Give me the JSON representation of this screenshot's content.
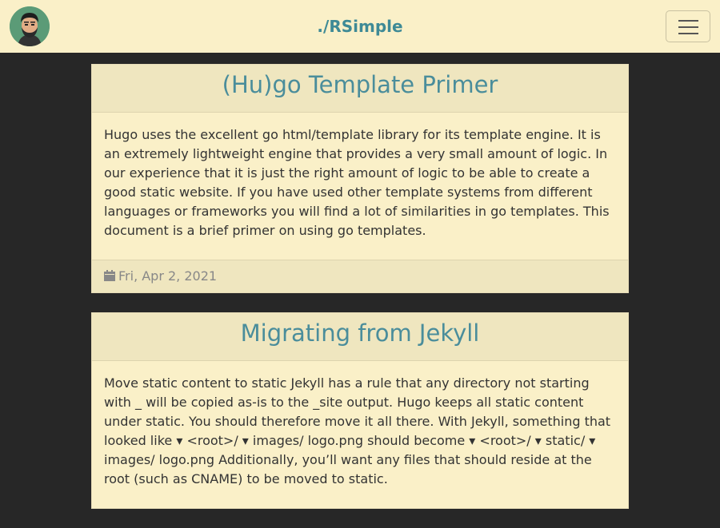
{
  "navbar": {
    "brand": "./RSimple",
    "avatar_icon": "avatar-icon",
    "menu_icon": "hamburger-menu-icon"
  },
  "posts": [
    {
      "title": "(Hu)go Template Primer",
      "summary": "Hugo uses the excellent go html/template library for its template engine. It is an extremely lightweight engine that provides a very small amount of logic. In our experience that it is just the right amount of logic to be able to create a good static website. If you have used other template systems from different languages or frameworks you will find a lot of similarities in go templates. This document is a brief primer on using go templates.",
      "date": "Fri, Apr 2, 2021"
    },
    {
      "title": "Migrating from Jekyll",
      "summary": "Move static content to static Jekyll has a rule that any directory not starting with _ will be copied as-is to the _site output. Hugo keeps all static content under static. You should therefore move it all there. With Jekyll, something that looked like ▾ <root>/ ▾ images/ logo.png should become ▾ <root>/ ▾ static/ ▾ images/ logo.png Additionally, you’ll want any files that should reside at the root (such as CNAME) to be moved to static.",
      "date": ""
    }
  ],
  "colors": {
    "page_bg": "#272727",
    "card_bg": "#faf0c8",
    "accent": "#4a8d9b"
  }
}
